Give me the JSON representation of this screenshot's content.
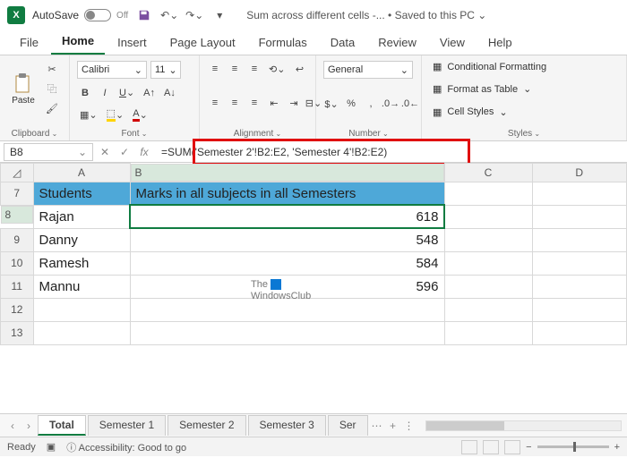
{
  "titlebar": {
    "autosave_label": "AutoSave",
    "autosave_state": "Off",
    "doc_title": "Sum across different cells -... • Saved to this PC ",
    "chevron": "⌄"
  },
  "tabs": [
    "File",
    "Home",
    "Insert",
    "Page Layout",
    "Formulas",
    "Data",
    "Review",
    "View",
    "Help"
  ],
  "tabs_active": 1,
  "ribbon": {
    "clipboard": {
      "paste": "Paste",
      "label": "Clipboard"
    },
    "font": {
      "name": "Calibri",
      "size": "11",
      "label": "Font"
    },
    "alignment": {
      "label": "Alignment"
    },
    "number": {
      "format": "General",
      "label": "Number"
    },
    "styles": {
      "cond": "Conditional Formatting",
      "table": "Format as Table ",
      "cell": "Cell Styles ",
      "label": "Styles"
    }
  },
  "formula_bar": {
    "namebox": "B8",
    "formula": "=SUM('Semester 2'!B2:E2, 'Semester 4'!B2:E2)"
  },
  "grid": {
    "col_headers": [
      "A",
      "B",
      "C",
      "D"
    ],
    "rows": [
      {
        "n": "7",
        "a": "Students",
        "b": "Marks in all subjects in all Semesters",
        "header": true
      },
      {
        "n": "8",
        "a": "Rajan",
        "b": "618",
        "active": true
      },
      {
        "n": "9",
        "a": "Danny",
        "b": "548"
      },
      {
        "n": "10",
        "a": "Ramesh",
        "b": "584"
      },
      {
        "n": "11",
        "a": "Mannu",
        "b": "596"
      },
      {
        "n": "12",
        "a": "",
        "b": ""
      },
      {
        "n": "13",
        "a": "",
        "b": ""
      }
    ]
  },
  "watermark": {
    "line1": "The",
    "line2": "WindowsClub"
  },
  "sheets": [
    "Total",
    "Semester 1",
    "Semester 2",
    "Semester 3",
    "Ser"
  ],
  "sheets_active": 0,
  "statusbar": {
    "ready": "Ready",
    "access": "Accessibility: Good to go",
    "zoom": "— ——— +"
  }
}
